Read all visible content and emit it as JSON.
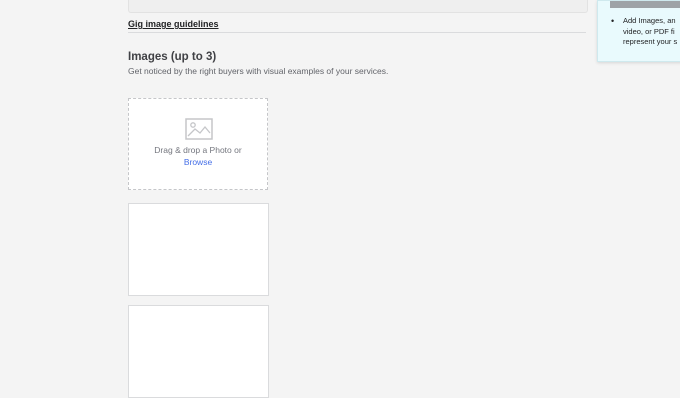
{
  "guidelines": {
    "link_label": "Gig image guidelines"
  },
  "images_section": {
    "title": "Images (up to 3)",
    "description": "Get noticed by the right buyers with visual examples of your services.",
    "dropzone": {
      "icon": "photo-icon",
      "text": "Drag & drop a Photo or",
      "browse_label": "Browse"
    }
  },
  "tip_panel": {
    "bullet": "•",
    "lines": [
      "Add Images, an",
      "video, or PDF fi",
      "represent your s"
    ]
  },
  "colors": {
    "link_blue": "#446ee7",
    "tip_background": "#e9fafd",
    "page_background": "#f4f4f4"
  }
}
